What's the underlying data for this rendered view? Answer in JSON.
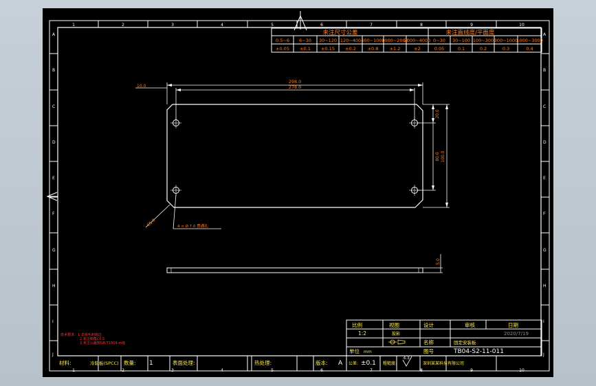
{
  "border": {
    "col_labels": [
      "1",
      "2",
      "3",
      "4",
      "5",
      "6",
      "7",
      "8",
      "9",
      "10"
    ],
    "row_labels": [
      "A",
      "B",
      "C",
      "D",
      "E",
      "F",
      "G",
      "H",
      "I",
      "J"
    ]
  },
  "tolerance": {
    "linear_title": "未注尺寸公差",
    "angular_title": "未注直线度/平面度",
    "linear_ranges": [
      "0.5~6",
      "6~30",
      "30~120",
      "120~400",
      "400~1000",
      "1000~2000",
      "2000~4000"
    ],
    "linear_values": [
      "±0.05",
      "±0.1",
      "±0.15",
      "±0.2",
      "±0.8",
      "±1.2",
      "±2"
    ],
    "angular_ranges": [
      "0~30",
      "30~100",
      "100~300",
      "300~1000",
      "1000~3000"
    ],
    "angular_values": [
      "0.05",
      "0.1",
      "0.2",
      "0.3",
      "0.4"
    ]
  },
  "dims": {
    "overall": "298.0",
    "holes": "278.0",
    "left": "10.0",
    "right_small": "20.0",
    "right_big": "80.0",
    "right_total": "100.0",
    "chamfer": "C5.0",
    "holes_note": "4 × Ø 7.0 贯通孔",
    "thickness": "5.0"
  },
  "notes": {
    "lines": [
      "技术要求：1.去除毛刺锐边",
      "2.未注倒角C0.5",
      "3.未注公差按GB/T1804-m级"
    ]
  },
  "title_block": {
    "scale_label": "比例",
    "scale_value": "1:2",
    "view_label": "视图",
    "view_value": "投影",
    "design_label": "设计",
    "review_label": "审核",
    "date_label": "日期",
    "date_value": "2020/7/19",
    "name_label": "名称",
    "name_value": "固定安装板",
    "unit_label": "单位",
    "unit_value": "mm",
    "drawing_no_label": "图号",
    "drawing_no_value": "TB04-S2-11-011",
    "material_label": "材料:",
    "material_value": "冷轧板(SPCC)",
    "qty_label": "数量:",
    "qty_value": "1",
    "surface_label": "表面处理:",
    "surface_value": "",
    "heat_label": "热处理:",
    "heat_value": "",
    "version_label": "版本:",
    "version_value": "A",
    "tolerance_label": "公差:",
    "tolerance_value": "±0.1",
    "roughness_label": "粗糙度:",
    "roughness_value": "6.3",
    "company": "深圳某某科技有限公司"
  }
}
